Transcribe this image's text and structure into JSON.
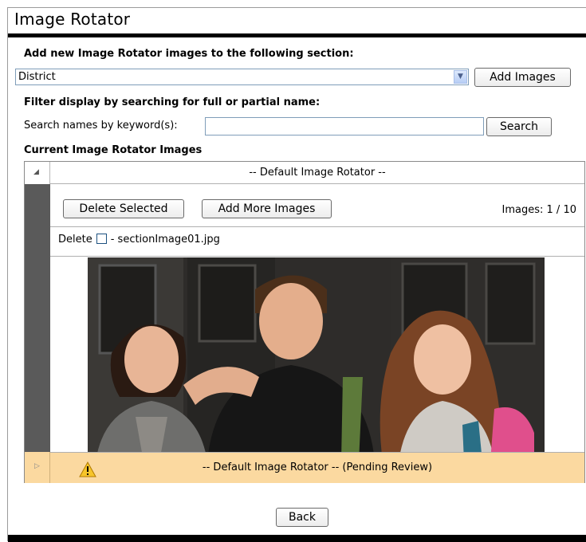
{
  "title": "Image Rotator",
  "add_section": {
    "label": "Add new Image Rotator images to the following section:",
    "selected": "District",
    "add_button": "Add Images"
  },
  "filter": {
    "label": "Filter display by searching for full or partial name:",
    "search_label": "Search names by keyword(s):",
    "search_value": "",
    "search_button": "Search"
  },
  "current": {
    "label": "Current Image Rotator Images",
    "group_title": "-- Default Image Rotator --",
    "delete_selected": "Delete Selected",
    "add_more": "Add More Images",
    "images_count": "Images: 1 / 10",
    "delete_label": "Delete",
    "file_name": "- sectionImage01.jpg",
    "pending_title": "-- Default Image Rotator -- (Pending Review)"
  },
  "back_button": "Back",
  "colors": {
    "pending_bg": "#fbd9a0",
    "gutter": "#5a5a5a",
    "rule": "#000000"
  }
}
